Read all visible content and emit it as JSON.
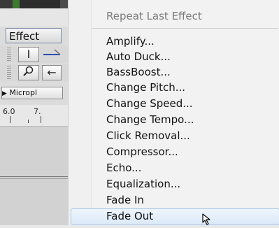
{
  "app": {
    "effect_menu_label": "Effect",
    "toolbar": {
      "ibeam_glyph": "I",
      "zoom_glyph": "⚲",
      "arrow_glyph": "←"
    },
    "device_label": "Micropl",
    "ruler": {
      "ticks": [
        "6.0",
        "7."
      ]
    }
  },
  "menu": {
    "repeat_last_effect": "Repeat Last Effect",
    "items": [
      "Amplify...",
      "Auto Duck...",
      "BassBoost...",
      "Change Pitch...",
      "Change Speed...",
      "Change Tempo...",
      "Click Removal...",
      "Compressor...",
      "Echo...",
      "Equalization...",
      "Fade In",
      "Fade Out"
    ],
    "highlighted_item": "Fade Out"
  },
  "icons": [
    "mouse-cursor-icon",
    "zoom-icon",
    "arrow-icon",
    "ibeam-icon"
  ],
  "colors": {
    "menu_background": "#f2f2f2",
    "highlight_border": "#a9c6e6",
    "highlight_fill": "#dbe9f8",
    "disabled_text": "#7a7a7a"
  }
}
